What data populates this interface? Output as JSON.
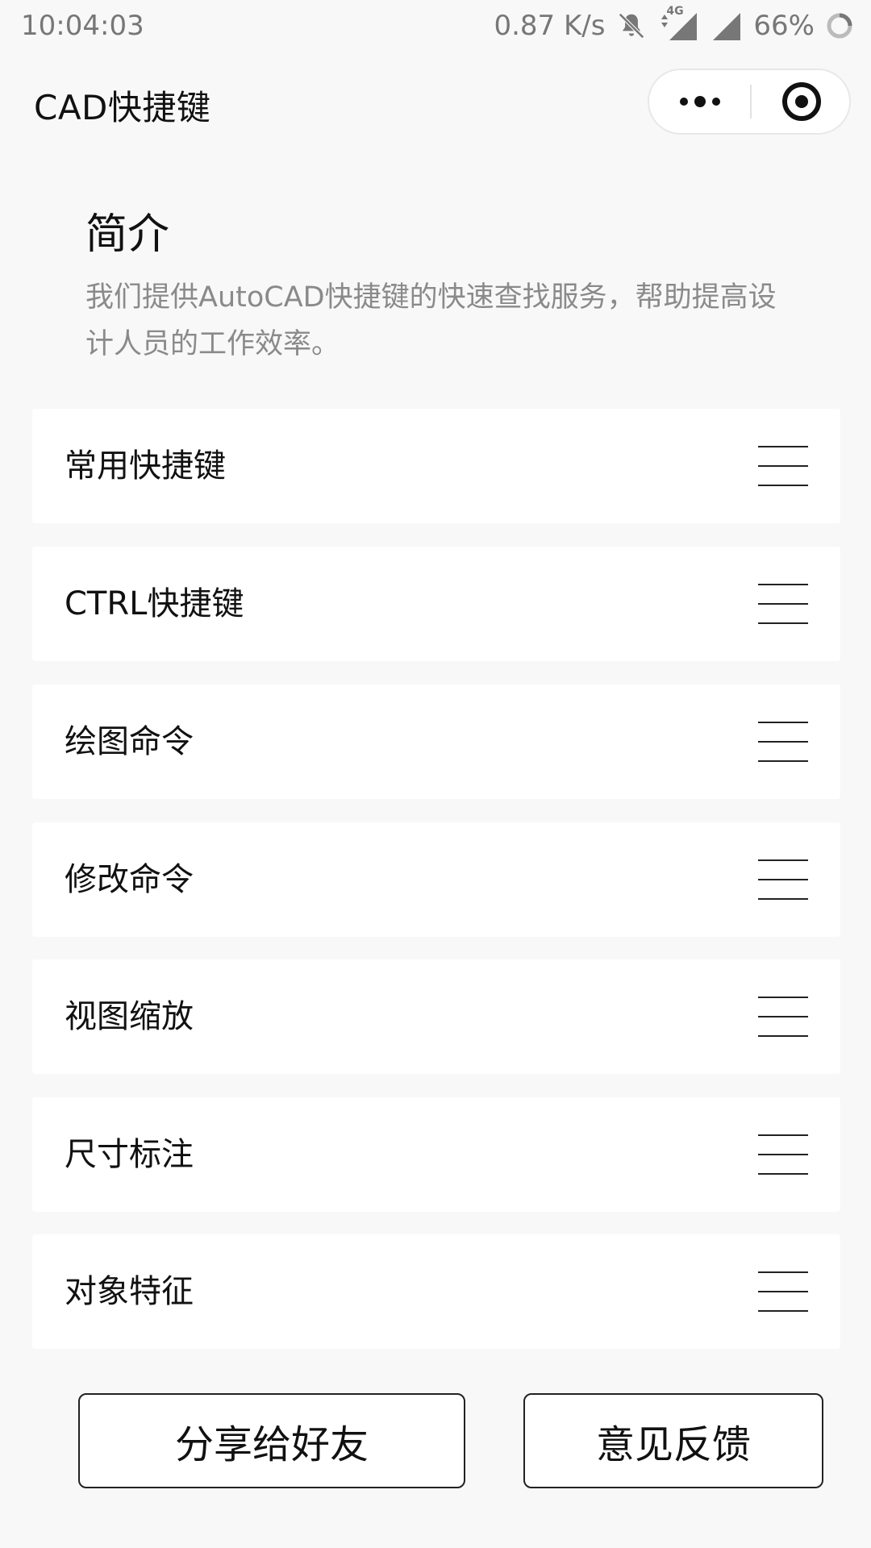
{
  "status_bar": {
    "time": "10:04:03",
    "speed": "0.87 K/s",
    "network": "4G",
    "battery": "66%"
  },
  "nav": {
    "title": "CAD快捷键"
  },
  "intro": {
    "heading": "简介",
    "text": "我们提供AutoCAD快捷键的快速查找服务，帮助提高设计人员的工作效率。"
  },
  "menu": {
    "items": [
      {
        "label": "常用快捷键"
      },
      {
        "label": "CTRL快捷键"
      },
      {
        "label": "绘图命令"
      },
      {
        "label": "修改命令"
      },
      {
        "label": "视图缩放"
      },
      {
        "label": "尺寸标注"
      },
      {
        "label": "对象特征"
      }
    ]
  },
  "buttons": {
    "share": "分享给好友",
    "feedback": "意见反馈"
  },
  "icons": {
    "more": "more-dots-icon",
    "close": "target-circle-icon",
    "menu": "hamburger-icon"
  }
}
